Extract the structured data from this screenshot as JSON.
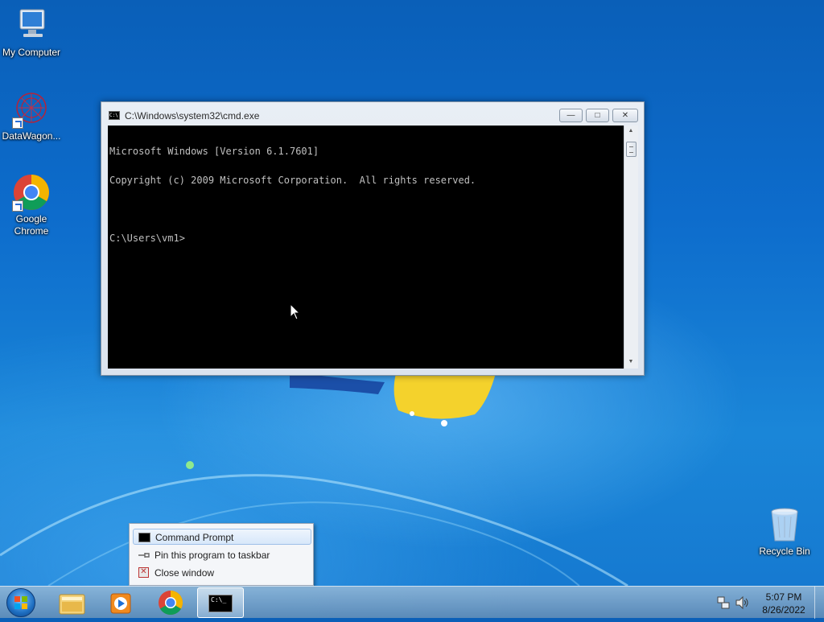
{
  "desktop": {
    "icons": [
      {
        "label": "My Computer",
        "icon": "computer-icon"
      },
      {
        "label": "DataWagon...",
        "icon": "datawagon-icon"
      },
      {
        "label": "Google Chrome",
        "icon": "chrome-icon"
      },
      {
        "label": "Recycle Bin",
        "icon": "recycle-bin-icon"
      }
    ]
  },
  "window": {
    "title": "C:\\Windows\\system32\\cmd.exe",
    "icon_label": "C:\\",
    "controls": {
      "minimize": "—",
      "maximize": "□",
      "close": "✕"
    },
    "console_lines": [
      "Microsoft Windows [Version 6.1.7601]",
      "Copyright (c) 2009 Microsoft Corporation.  All rights reserved.",
      "",
      "C:\\Users\\vm1>"
    ],
    "scroll": {
      "up": "▲",
      "down": "▼"
    }
  },
  "jumplist": {
    "items": [
      {
        "label": "Command Prompt",
        "icon": "cmd-icon"
      },
      {
        "label": "Pin this program to taskbar",
        "icon": "pin-icon"
      },
      {
        "label": "Close window",
        "icon": "close-window-icon"
      }
    ]
  },
  "taskbar": {
    "items": [
      "start-orb",
      "explorer-icon",
      "media-player-icon",
      "chrome-icon",
      "cmd-icon"
    ],
    "cmd_icon_text": "C:\\_",
    "clock": {
      "time": "5:07 PM",
      "date": "8/26/2022"
    }
  }
}
